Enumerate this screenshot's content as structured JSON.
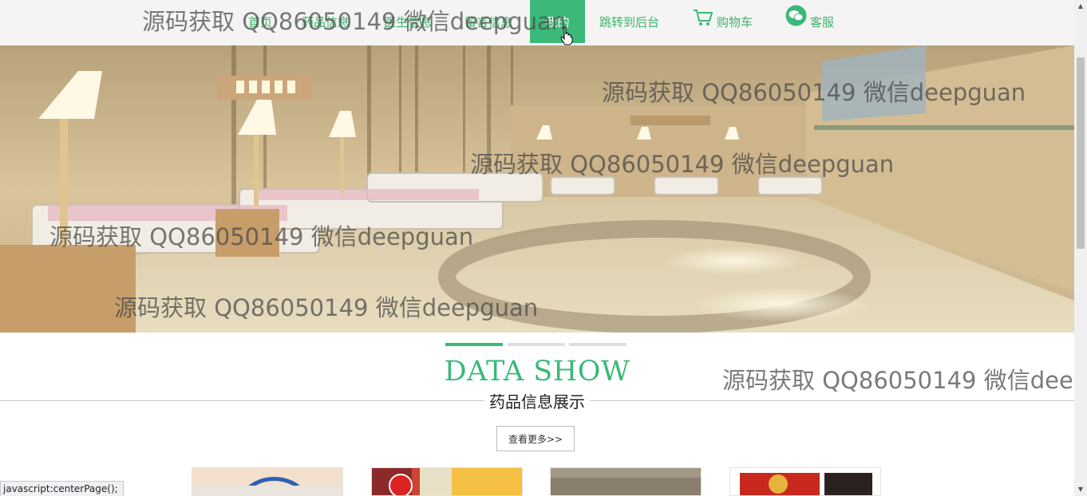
{
  "nav": {
    "items": [
      {
        "label": "首页"
      },
      {
        "label": "药品信息"
      },
      {
        "label": "医生信息"
      },
      {
        "label": "留言信息"
      },
      {
        "label": "我的"
      },
      {
        "label": "跳转到后台"
      },
      {
        "label": "购物车"
      },
      {
        "label": "客服"
      }
    ]
  },
  "section": {
    "title_en": "DATA SHOW",
    "title_cn": "药品信息展示",
    "more_label": "查看更多>>"
  },
  "status_bar": "javascript:centerPage();",
  "watermark": "源码获取 QQ86050149 微信deepguan",
  "colors": {
    "accent": "#3cb878",
    "nav_bg": "#f4f4f4"
  }
}
